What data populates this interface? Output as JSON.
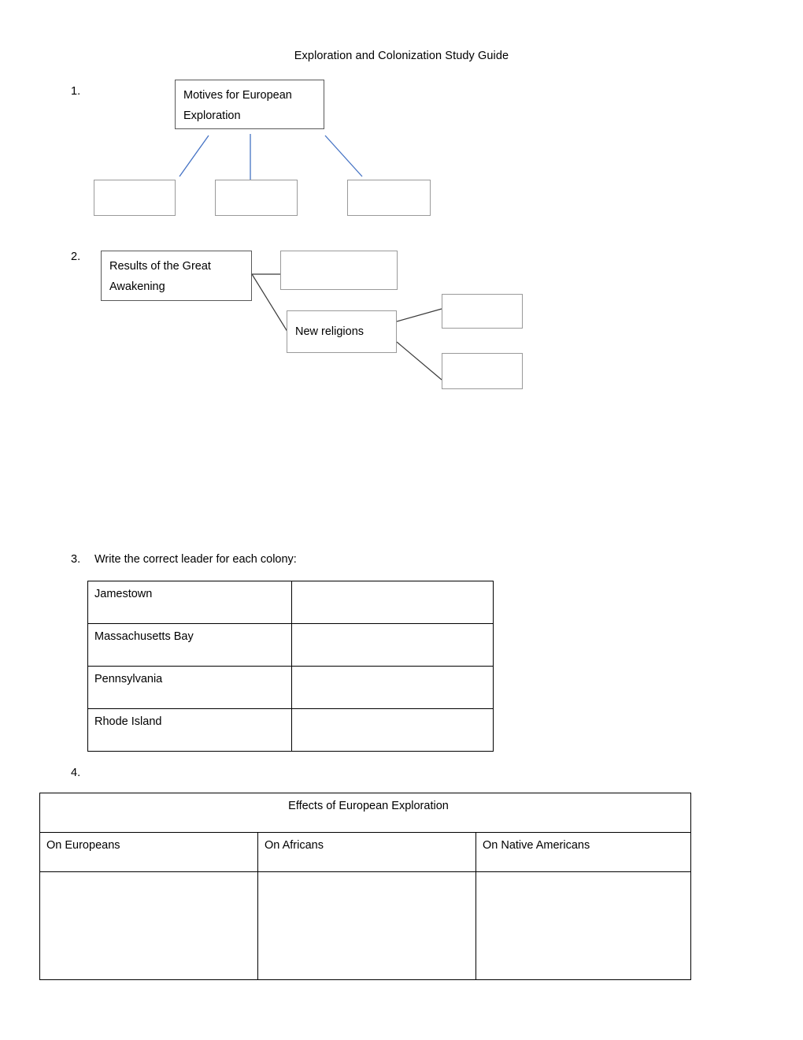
{
  "document": {
    "title": "Exploration and Colonization Study Guide"
  },
  "sections": {
    "one": {
      "number": "1.",
      "root_box": "Motives for European Exploration",
      "child_boxes": [
        "",
        "",
        ""
      ],
      "connector_color": "#4472C4"
    },
    "two": {
      "number": "2.",
      "root_box": "Results of the Great Awakening",
      "top_box": "",
      "mid_box": "New religions",
      "right_boxes": [
        "",
        ""
      ],
      "connector_color": "#3A3A3A"
    },
    "three": {
      "number": "3.",
      "prompt": "Write the correct leader for each colony:",
      "rows": [
        {
          "colony": "Jamestown",
          "leader": ""
        },
        {
          "colony": "Massachusetts Bay",
          "leader": ""
        },
        {
          "colony": "Pennsylvania",
          "leader": ""
        },
        {
          "colony": "Rhode Island",
          "leader": ""
        }
      ]
    },
    "four": {
      "number": "4.",
      "table_title": "Effects of European Exploration",
      "column_headers": [
        "On Europeans",
        "On Africans",
        "On Native Americans"
      ],
      "answer_cells": [
        "",
        "",
        ""
      ]
    }
  }
}
